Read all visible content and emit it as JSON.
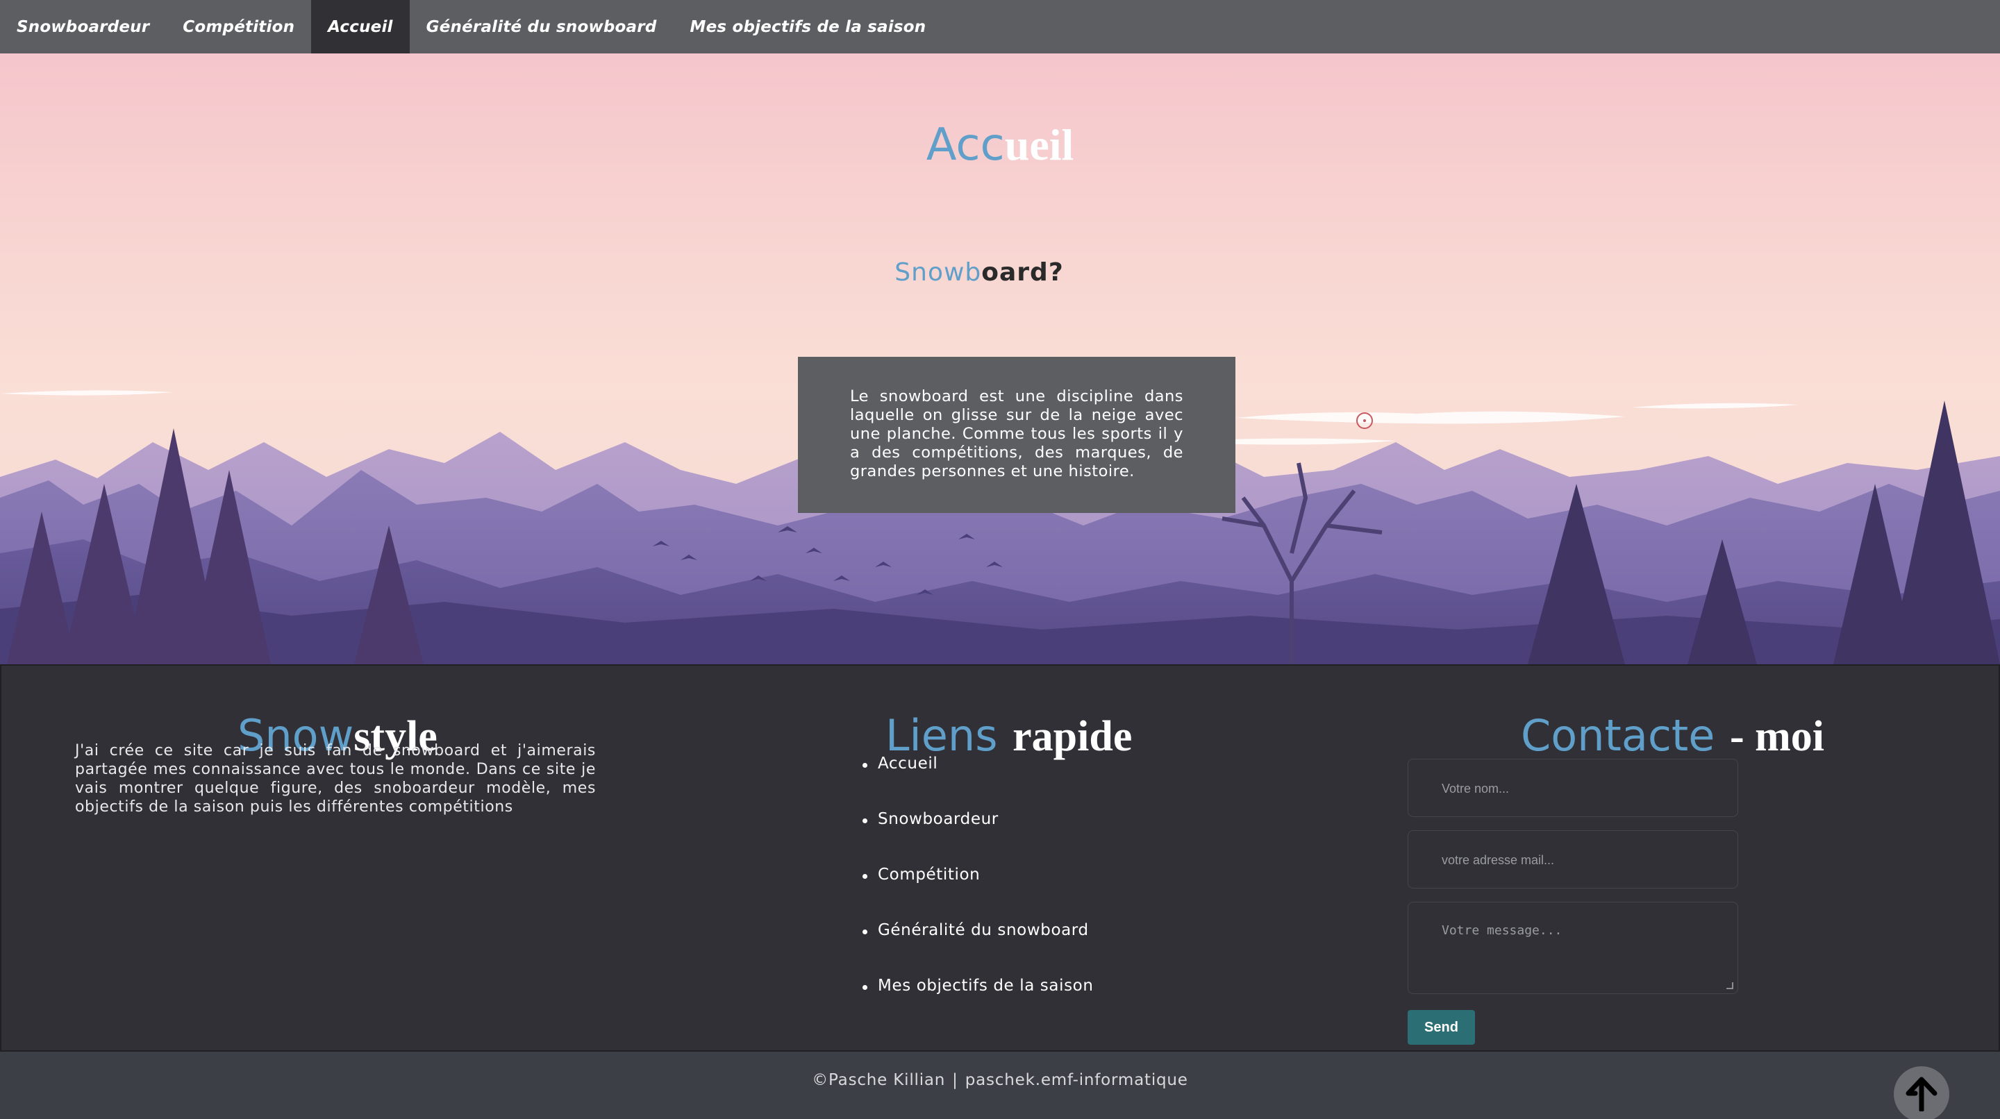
{
  "nav": {
    "items": [
      {
        "label": "Snowboardeur",
        "active": false
      },
      {
        "label": "Compétition",
        "active": false
      },
      {
        "label": "Accueil",
        "active": true
      },
      {
        "label": "Généralité du snowboard",
        "active": false
      },
      {
        "label": "Mes objectifs de la saison",
        "active": false
      }
    ]
  },
  "hero": {
    "title_part1": "Acc",
    "title_part2": "ueil",
    "subtitle_part1": "Snowb",
    "subtitle_part2": "oard?",
    "description": "Le snowboard est une discipline dans laquelle on glisse sur de la neige avec une planche. Comme tous les sports il y a des compétitions, des marques, de grandes personnes et une histoire."
  },
  "about": {
    "title_part1": "Snow",
    "title_part2": "style",
    "text": "J'ai crée ce site car je suis fan de snowboard et j'aimerais partagée mes connaissance avec tous le monde. Dans ce site je vais montrer quelque figure, des snoboardeur modèle, mes objectifs de la saison puis les différentes compétitions"
  },
  "links": {
    "title_part1": "Liens",
    "title_part2": "rapide",
    "items": [
      "Accueil",
      "Snowboardeur",
      "Compétition",
      "Généralité du snowboard",
      "Mes objectifs de la saison"
    ]
  },
  "contact": {
    "title_part1": "Contacte",
    "title_part2": "- moi",
    "name_placeholder": "Votre nom...",
    "email_placeholder": "votre adresse mail...",
    "message_placeholder": "Votre message...",
    "send_label": "Send"
  },
  "footer": {
    "copyright": "©Pasche Killian",
    "separator": "|",
    "site": "paschek.emf-informatique"
  },
  "icons": {
    "scroll_top": "arrow-up-icon"
  },
  "colors": {
    "nav_bg": "#5d5e62",
    "nav_active": "#313135",
    "accent_blue": "#5f9fc9",
    "panel_bg": "#303036",
    "send_button": "#2b6f75"
  }
}
